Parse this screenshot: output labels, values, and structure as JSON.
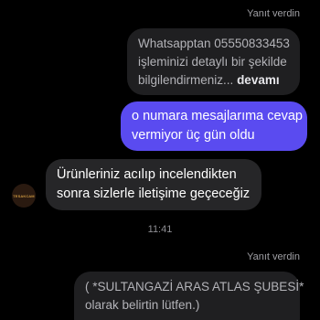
{
  "thread": {
    "reply_label_1": "Yanıt verdin",
    "quoted_1": {
      "line1": "Whatsapptan 05550833453",
      "line2": "işleminizi detaylı bir şekilde",
      "line3": "bilgilendirmeniz...",
      "more": "devamı"
    },
    "sent_message": {
      "line1": "o numara mesajlarıma cevap",
      "line2": "vermiyor üç gün oldu"
    },
    "received_message": {
      "line1": "Ürünleriniz acılıp incelendikten",
      "line2": "sonra sizlerle iletişime geçeceğiz"
    },
    "avatar_text": "TESAKCAM",
    "timestamp": "11:41",
    "reply_label_2": "Yanıt verdin",
    "quoted_2": {
      "line1": "( *SULTANGAZİ ARAS ATLAS ŞUBESİ*",
      "line2": "olarak belirtin lütfen.)"
    }
  },
  "colors": {
    "background": "#000000",
    "sent_bubble": "#5a4bf0",
    "received_bubble": "#262628",
    "quoted_bubble": "#1f1f21"
  }
}
